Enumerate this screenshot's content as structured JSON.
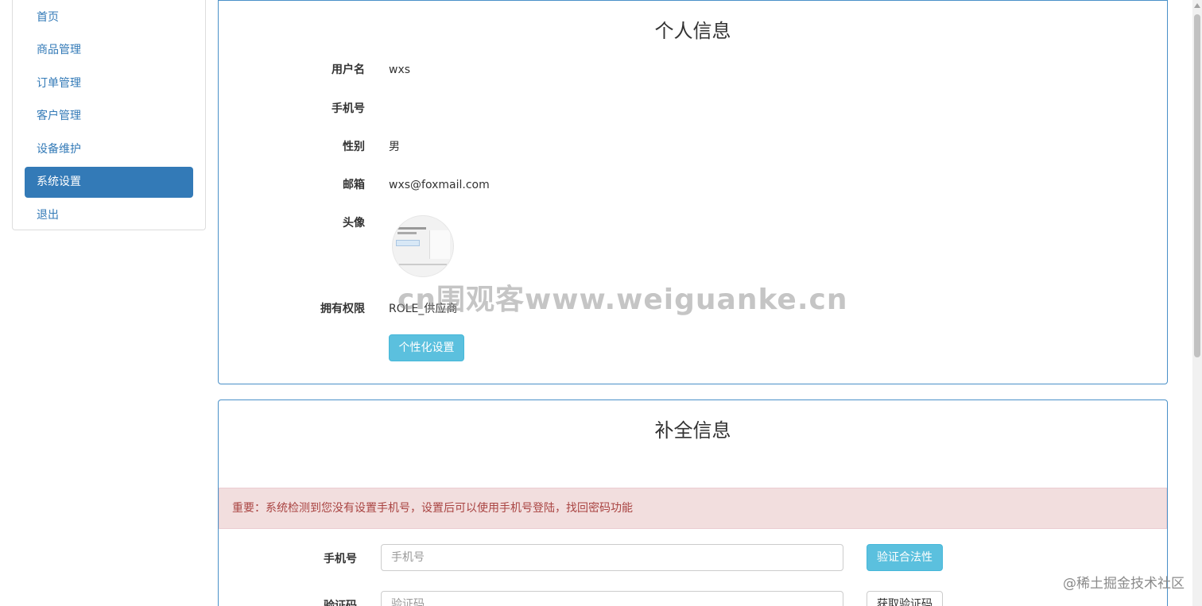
{
  "sidebar": {
    "items": [
      {
        "label": "首页"
      },
      {
        "label": "商品管理"
      },
      {
        "label": "订单管理"
      },
      {
        "label": "客户管理"
      },
      {
        "label": "设备维护"
      },
      {
        "label": "系统设置",
        "active": true
      },
      {
        "label": "退出"
      }
    ]
  },
  "profile": {
    "title": "个人信息",
    "username_label": "用户名",
    "username": "wxs",
    "phone_label": "手机号",
    "phone": "",
    "gender_label": "性别",
    "gender": "男",
    "email_label": "邮箱",
    "email": "wxs@foxmail.com",
    "avatar_label": "头像",
    "role_label": "拥有权限",
    "role": "ROLE_供应商",
    "personalize_button": "个性化设置"
  },
  "complete": {
    "title": "补全信息",
    "alert": "重要：系统检测到您没有设置手机号，设置后可以使用手机号登陆，找回密码功能",
    "phone_label": "手机号",
    "phone_placeholder": "手机号",
    "verify_button": "验证合法性",
    "code_label": "验证码",
    "code_placeholder": "验证码",
    "get_code_button": "获取验证码"
  },
  "watermark": "cn围观客www.weiguanke.cn",
  "credit": "@稀土掘金技术社区",
  "colors": {
    "primary": "#337ab7",
    "info": "#5bc0de",
    "danger_bg": "#f2dede",
    "danger_text": "#a94442"
  }
}
